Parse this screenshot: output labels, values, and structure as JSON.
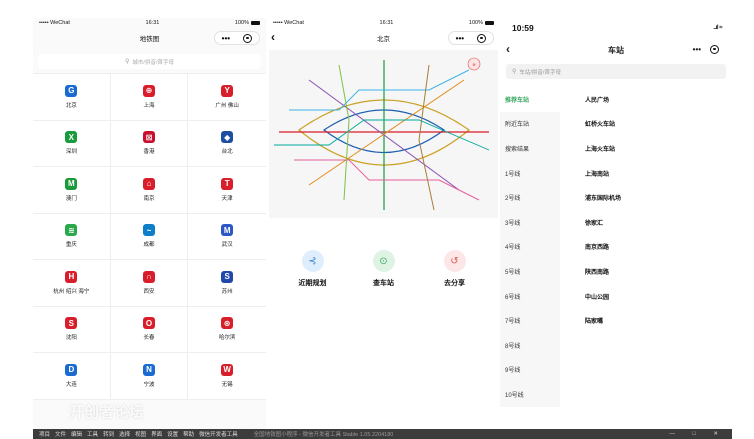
{
  "panel1": {
    "status": {
      "carrier": "••••• WeChat",
      "time": "16:31",
      "battery": "100%"
    },
    "title": "地铁图",
    "capsule": {
      "more": "•••"
    },
    "search_placeholder": "城市/拼音/首字母",
    "cities": [
      {
        "name": "北京",
        "color": "#1a6bd1",
        "glyph": "G"
      },
      {
        "name": "上海",
        "color": "#d81e2a",
        "glyph": "⊕"
      },
      {
        "name": "广州 佛山",
        "color": "#d81e2a",
        "glyph": "Y"
      },
      {
        "name": "深圳",
        "color": "#1a9b3b",
        "glyph": "X"
      },
      {
        "name": "香港",
        "color": "#c8102e",
        "glyph": "⊠"
      },
      {
        "name": "台北",
        "color": "#1d4fa1",
        "glyph": "◆"
      },
      {
        "name": "澳门",
        "color": "#1a9b3b",
        "glyph": "M"
      },
      {
        "name": "南京",
        "color": "#d81e2a",
        "glyph": "⌂"
      },
      {
        "name": "天津",
        "color": "#d81e2a",
        "glyph": "T"
      },
      {
        "name": "重庆",
        "color": "#2aa84a",
        "glyph": "≋"
      },
      {
        "name": "成都",
        "color": "#0d7fc9",
        "glyph": "~"
      },
      {
        "name": "武汉",
        "color": "#2c57c6",
        "glyph": "M"
      },
      {
        "name": "杭州 绍兴 海宁",
        "color": "#d81e2a",
        "glyph": "H"
      },
      {
        "name": "西安",
        "color": "#d81e2a",
        "glyph": "∩"
      },
      {
        "name": "苏州",
        "color": "#2049a8",
        "glyph": "S"
      },
      {
        "name": "沈阳",
        "color": "#d81e2a",
        "glyph": "S"
      },
      {
        "name": "长春",
        "color": "#d81e2a",
        "glyph": "O"
      },
      {
        "name": "哈尔滨",
        "color": "#d81e2a",
        "glyph": "⊛"
      },
      {
        "name": "大连",
        "color": "#1a6bd1",
        "glyph": "D"
      },
      {
        "name": "宁波",
        "color": "#1a6bd1",
        "glyph": "N"
      },
      {
        "name": "无锡",
        "color": "#d81e2a",
        "glyph": "W"
      }
    ]
  },
  "panel2": {
    "status": {
      "carrier": "••••• WeChat",
      "time": "16:31",
      "battery": "100%"
    },
    "title": "北京",
    "capsule": {
      "more": "•••"
    },
    "actions": [
      {
        "label": "近期规划",
        "icon": "arrow-icon",
        "glyph": "⊰",
        "bg": "#dfeefc",
        "fg": "#3e86d6"
      },
      {
        "label": "查车站",
        "icon": "pin-icon",
        "glyph": "⊙",
        "bg": "#dff3e4",
        "fg": "#3aa860"
      },
      {
        "label": "去分享",
        "icon": "share-icon",
        "glyph": "↺",
        "bg": "#fde6e6",
        "fg": "#e05555"
      }
    ]
  },
  "panel3": {
    "status": {
      "time": "10:59",
      "signal": "..ıl ≈"
    },
    "title": "车站",
    "capsule": {
      "more": "•••"
    },
    "search_placeholder": "车站/拼音/首字母",
    "lines": [
      "推荐车站",
      "附近车站",
      "搜索结果",
      "1号线",
      "2号线",
      "3号线",
      "4号线",
      "5号线",
      "6号线",
      "7号线",
      "8号线",
      "9号线",
      "10号线"
    ],
    "active_line": 0,
    "stations": [
      "人民广场",
      "虹桥火车站",
      "上海火车站",
      "上海南站",
      "浦东国际机场",
      "徐家汇",
      "南京西路",
      "陕西南路",
      "中山公园",
      "陆家嘴"
    ],
    "accent": "#3aa860"
  },
  "taskbar": {
    "menu": [
      "项目",
      "文件",
      "编辑",
      "工具",
      "转到",
      "选择",
      "视图",
      "界面",
      "设置",
      "帮助",
      "微信开发者工具"
    ],
    "title": "全国地铁图小程序 - 微信开发者工具 Stable 1.05.2204180",
    "window_controls": "—  □  ✕"
  },
  "watermark": "开创者论坛"
}
